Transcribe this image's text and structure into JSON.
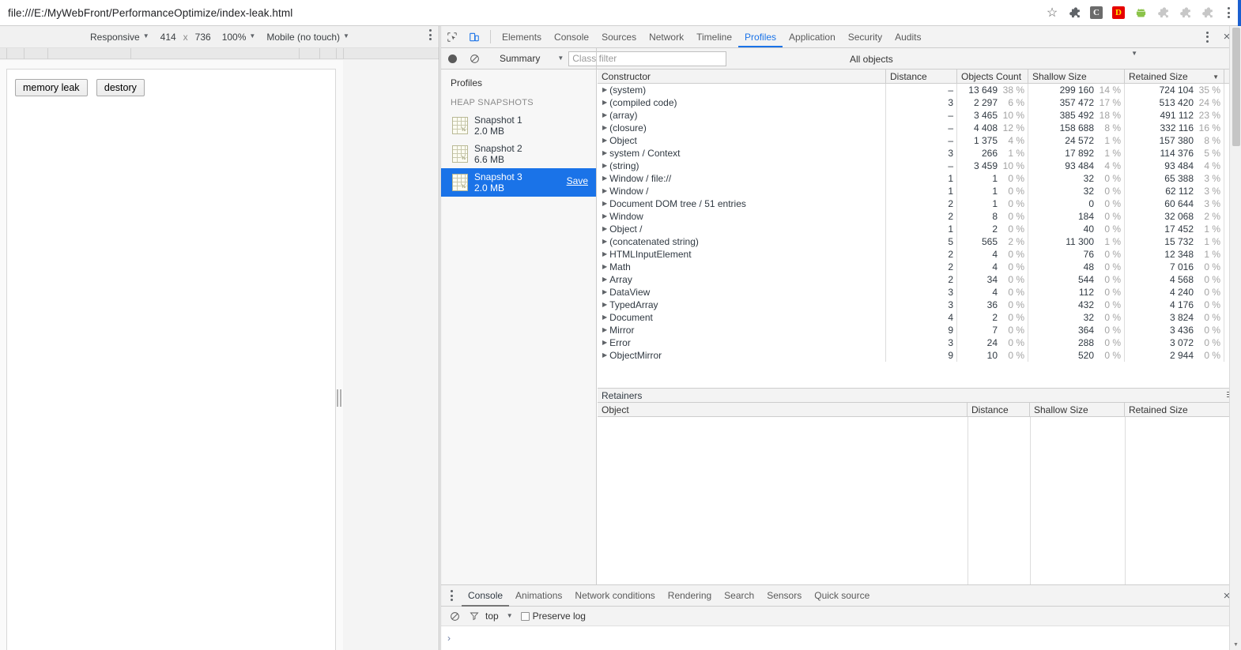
{
  "browser": {
    "url": "file:///E:/MyWebFront/PerformanceOptimize/index-leak.html",
    "star_icon": "☆",
    "extensions": [
      {
        "name": "puzzle-extension-icon",
        "type": "puzzle",
        "color": "#5f6368",
        "label": ""
      },
      {
        "name": "c-extension-icon",
        "type": "square",
        "color": "#6b6b6b",
        "label": "C"
      },
      {
        "name": "d-extension-icon",
        "type": "square",
        "color": "#e60000",
        "label": "D"
      },
      {
        "name": "android-extension-icon",
        "type": "android",
        "color": "#8bc34a",
        "label": ""
      },
      {
        "name": "puzzle-extension-icon-2",
        "type": "puzzle",
        "color": "#c7c7c7",
        "label": ""
      },
      {
        "name": "puzzle-extension-icon-3",
        "type": "puzzle",
        "color": "#c7c7c7",
        "label": ""
      },
      {
        "name": "puzzle-extension-icon-4",
        "type": "puzzle",
        "color": "#c7c7c7",
        "label": ""
      }
    ],
    "menu_icon": "chrome-menu-icon"
  },
  "device_toolbar": {
    "device": "Responsive",
    "width": "414",
    "sep": "x",
    "height": "736",
    "zoom": "100%",
    "throttling": "Mobile (no touch)",
    "menu_icon": "device-more-options-icon"
  },
  "page": {
    "buttons": [
      {
        "label": "memory leak",
        "name": "memory-leak-button"
      },
      {
        "label": "destory",
        "name": "destory-button"
      }
    ]
  },
  "devtools": {
    "inspect_icon": "inspect-element-icon",
    "device_toggle_icon": "toggle-device-toolbar-icon",
    "tabs": [
      {
        "label": "Elements",
        "active": false
      },
      {
        "label": "Console",
        "active": false
      },
      {
        "label": "Sources",
        "active": false
      },
      {
        "label": "Network",
        "active": false
      },
      {
        "label": "Timeline",
        "active": false
      },
      {
        "label": "Profiles",
        "active": true
      },
      {
        "label": "Application",
        "active": false
      },
      {
        "label": "Security",
        "active": false
      },
      {
        "label": "Audits",
        "active": false
      }
    ],
    "more_icon": "devtools-more-options-icon",
    "close_icon": "×",
    "accent_color": "#1a73e8"
  },
  "profiler_toolbar": {
    "record_icon": "record-icon",
    "clear_icon": "clear-icon",
    "view_mode": "Summary",
    "class_filter_placeholder": "Class filter",
    "class_filter_value": "",
    "object_filter": "All objects"
  },
  "profiles_sidebar": {
    "title": "Profiles",
    "section_label": "HEAP SNAPSHOTS",
    "snapshots": [
      {
        "name": "Snapshot 1",
        "size": "2.0 MB",
        "selected": false,
        "save_label": ""
      },
      {
        "name": "Snapshot 2",
        "size": "6.6 MB",
        "selected": false,
        "save_label": ""
      },
      {
        "name": "Snapshot 3",
        "size": "2.0 MB",
        "selected": true,
        "save_label": "Save"
      }
    ]
  },
  "heap_grid": {
    "columns": [
      {
        "label": "Constructor",
        "sort": ""
      },
      {
        "label": "Distance",
        "sort": ""
      },
      {
        "label": "Objects Count",
        "sort": ""
      },
      {
        "label": "Shallow Size",
        "sort": ""
      },
      {
        "label": "Retained Size",
        "sort": "▼"
      }
    ],
    "rows": [
      {
        "constructor": "(system)",
        "distance": "–",
        "count": "13 649",
        "count_pct": "38 %",
        "shallow": "299 160",
        "shallow_pct": "14 %",
        "retained": "724 104",
        "retained_pct": "35 %"
      },
      {
        "constructor": "(compiled code)",
        "distance": "3",
        "count": "2 297",
        "count_pct": "6 %",
        "shallow": "357 472",
        "shallow_pct": "17 %",
        "retained": "513 420",
        "retained_pct": "24 %"
      },
      {
        "constructor": "(array)",
        "distance": "–",
        "count": "3 465",
        "count_pct": "10 %",
        "shallow": "385 492",
        "shallow_pct": "18 %",
        "retained": "491 112",
        "retained_pct": "23 %"
      },
      {
        "constructor": "(closure)",
        "distance": "–",
        "count": "4 408",
        "count_pct": "12 %",
        "shallow": "158 688",
        "shallow_pct": "8 %",
        "retained": "332 116",
        "retained_pct": "16 %"
      },
      {
        "constructor": "Object",
        "distance": "–",
        "count": "1 375",
        "count_pct": "4 %",
        "shallow": "24 572",
        "shallow_pct": "1 %",
        "retained": "157 380",
        "retained_pct": "8 %"
      },
      {
        "constructor": "system / Context",
        "distance": "3",
        "count": "266",
        "count_pct": "1 %",
        "shallow": "17 892",
        "shallow_pct": "1 %",
        "retained": "114 376",
        "retained_pct": "5 %"
      },
      {
        "constructor": "(string)",
        "distance": "–",
        "count": "3 459",
        "count_pct": "10 %",
        "shallow": "93 484",
        "shallow_pct": "4 %",
        "retained": "93 484",
        "retained_pct": "4 %"
      },
      {
        "constructor": "Window / file://",
        "distance": "1",
        "count": "1",
        "count_pct": "0 %",
        "shallow": "32",
        "shallow_pct": "0 %",
        "retained": "65 388",
        "retained_pct": "3 %"
      },
      {
        "constructor": "Window /",
        "distance": "1",
        "count": "1",
        "count_pct": "0 %",
        "shallow": "32",
        "shallow_pct": "0 %",
        "retained": "62 112",
        "retained_pct": "3 %"
      },
      {
        "constructor": "Document DOM tree / 51 entries",
        "distance": "2",
        "count": "1",
        "count_pct": "0 %",
        "shallow": "0",
        "shallow_pct": "0 %",
        "retained": "60 644",
        "retained_pct": "3 %"
      },
      {
        "constructor": "Window",
        "distance": "2",
        "count": "8",
        "count_pct": "0 %",
        "shallow": "184",
        "shallow_pct": "0 %",
        "retained": "32 068",
        "retained_pct": "2 %"
      },
      {
        "constructor": "Object /",
        "distance": "1",
        "count": "2",
        "count_pct": "0 %",
        "shallow": "40",
        "shallow_pct": "0 %",
        "retained": "17 452",
        "retained_pct": "1 %"
      },
      {
        "constructor": "(concatenated string)",
        "distance": "5",
        "count": "565",
        "count_pct": "2 %",
        "shallow": "11 300",
        "shallow_pct": "1 %",
        "retained": "15 732",
        "retained_pct": "1 %"
      },
      {
        "constructor": "HTMLInputElement",
        "distance": "2",
        "count": "4",
        "count_pct": "0 %",
        "shallow": "76",
        "shallow_pct": "0 %",
        "retained": "12 348",
        "retained_pct": "1 %"
      },
      {
        "constructor": "Math",
        "distance": "2",
        "count": "4",
        "count_pct": "0 %",
        "shallow": "48",
        "shallow_pct": "0 %",
        "retained": "7 016",
        "retained_pct": "0 %"
      },
      {
        "constructor": "Array",
        "distance": "2",
        "count": "34",
        "count_pct": "0 %",
        "shallow": "544",
        "shallow_pct": "0 %",
        "retained": "4 568",
        "retained_pct": "0 %"
      },
      {
        "constructor": "DataView",
        "distance": "3",
        "count": "4",
        "count_pct": "0 %",
        "shallow": "112",
        "shallow_pct": "0 %",
        "retained": "4 240",
        "retained_pct": "0 %"
      },
      {
        "constructor": "TypedArray",
        "distance": "3",
        "count": "36",
        "count_pct": "0 %",
        "shallow": "432",
        "shallow_pct": "0 %",
        "retained": "4 176",
        "retained_pct": "0 %"
      },
      {
        "constructor": "Document",
        "distance": "4",
        "count": "2",
        "count_pct": "0 %",
        "shallow": "32",
        "shallow_pct": "0 %",
        "retained": "3 824",
        "retained_pct": "0 %"
      },
      {
        "constructor": "Mirror",
        "distance": "9",
        "count": "7",
        "count_pct": "0 %",
        "shallow": "364",
        "shallow_pct": "0 %",
        "retained": "3 436",
        "retained_pct": "0 %"
      },
      {
        "constructor": "Error",
        "distance": "3",
        "count": "24",
        "count_pct": "0 %",
        "shallow": "288",
        "shallow_pct": "0 %",
        "retained": "3 072",
        "retained_pct": "0 %"
      },
      {
        "constructor": "ObjectMirror",
        "distance": "9",
        "count": "10",
        "count_pct": "0 %",
        "shallow": "520",
        "shallow_pct": "0 %",
        "retained": "2 944",
        "retained_pct": "0 %"
      }
    ]
  },
  "retainers": {
    "title": "Retainers",
    "menu_icon": "retainers-menu-icon",
    "columns": [
      {
        "label": "Object",
        "sort": ""
      },
      {
        "label": "Distance",
        "sort": "▲"
      },
      {
        "label": "Shallow Size",
        "sort": ""
      },
      {
        "label": "Retained Size",
        "sort": ""
      }
    ],
    "rows": []
  },
  "drawer": {
    "menu_icon": "drawer-more-options-icon",
    "tabs": [
      {
        "label": "Console",
        "active": true
      },
      {
        "label": "Animations",
        "active": false
      },
      {
        "label": "Network conditions",
        "active": false
      },
      {
        "label": "Rendering",
        "active": false
      },
      {
        "label": "Search",
        "active": false
      },
      {
        "label": "Sensors",
        "active": false
      },
      {
        "label": "Quick source",
        "active": false
      }
    ],
    "close_icon": "×",
    "console": {
      "clear_icon": "clear-console-icon",
      "filter_icon": "filter-icon",
      "context": "top",
      "preserve_log_label": "Preserve log",
      "preserve_log_checked": false,
      "prompt": "›",
      "input_value": ""
    }
  }
}
